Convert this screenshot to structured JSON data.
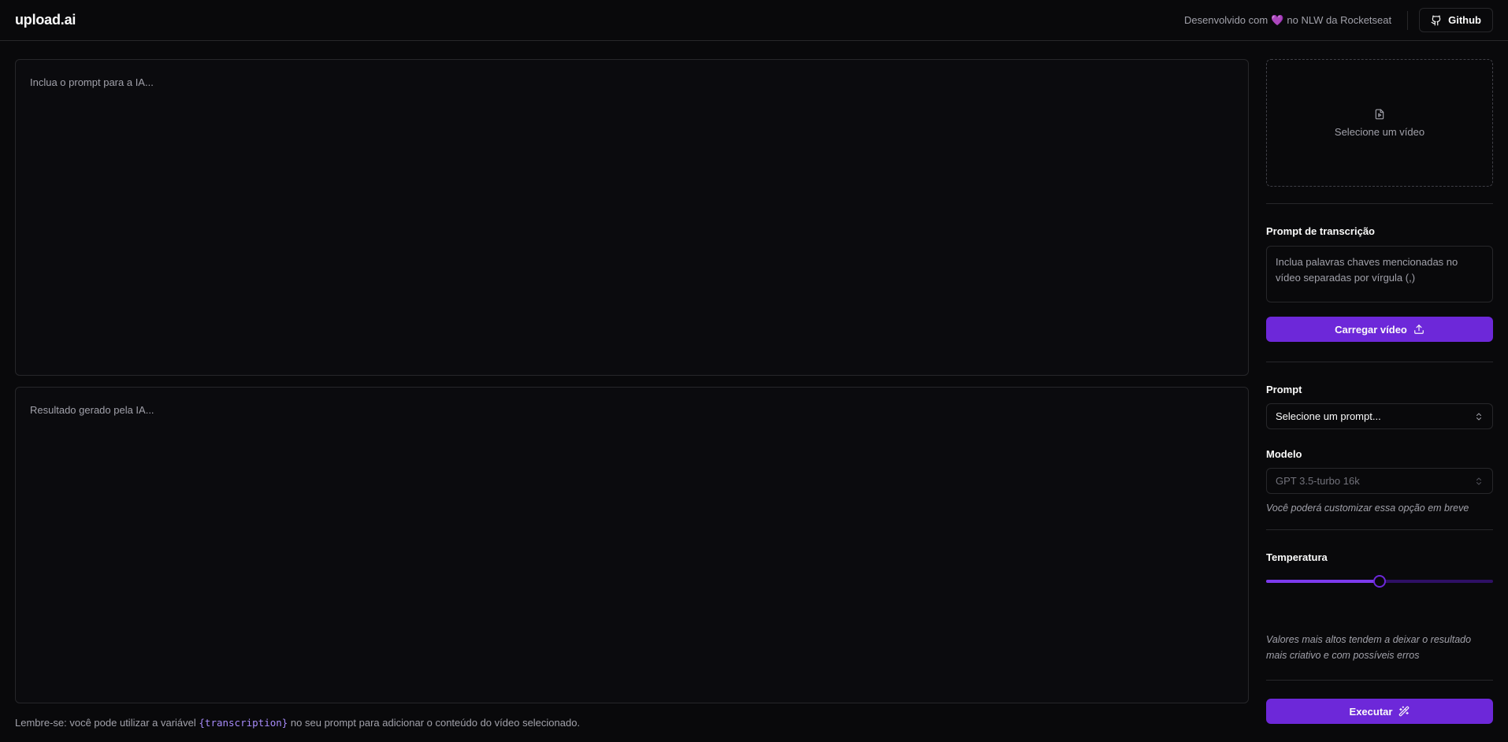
{
  "header": {
    "logo": "upload.ai",
    "credit_prefix": "Desenvolvido com",
    "credit_suffix": "no NLW da Rocketseat",
    "github_label": "Github"
  },
  "editor": {
    "prompt_placeholder": "Inclua o prompt para a IA...",
    "result_placeholder": "Resultado gerado pela IA..."
  },
  "hint": {
    "prefix": "Lembre-se: você pode utilizar a variável",
    "variable": "{transcription}",
    "suffix": "no seu prompt para adicionar o conteúdo do vídeo selecionado."
  },
  "sidebar": {
    "video_select_label": "Selecione um vídeo",
    "transcription_label": "Prompt de transcrição",
    "transcription_placeholder": "Inclua palavras chaves mencionadas no vídeo separadas por vírgula (,)",
    "upload_button": "Carregar vídeo",
    "prompt_label": "Prompt",
    "prompt_select": "Selecione um prompt...",
    "model_label": "Modelo",
    "model_select": "GPT 3.5-turbo 16k",
    "model_note": "Você poderá customizar essa opção em breve",
    "temperature_label": "Temperatura",
    "temperature_value": 0.5,
    "temperature_note": "Valores mais altos tendem a deixar o resultado mais criativo e com possíveis erros",
    "execute_button": "Executar"
  },
  "colors": {
    "accent": "#6d28d9",
    "background": "#09090b",
    "border": "#27272a",
    "muted_text": "#a1a1aa"
  }
}
